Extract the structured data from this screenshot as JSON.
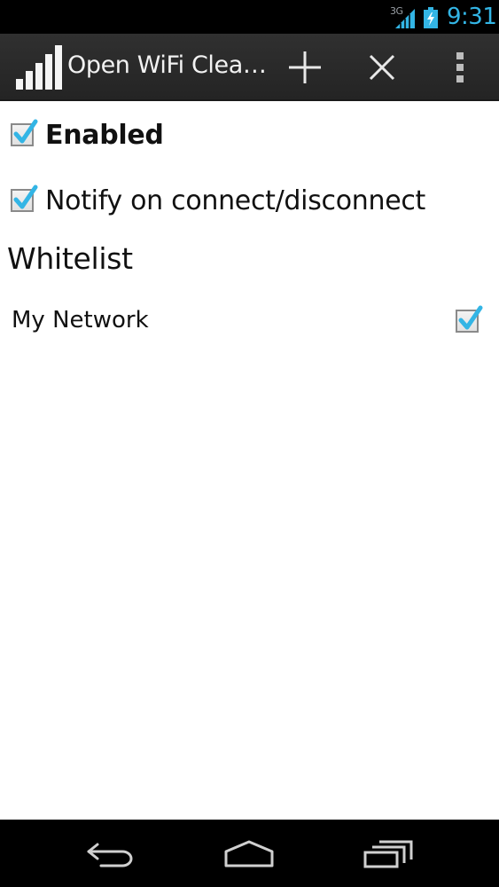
{
  "status_bar": {
    "network_type": "3G",
    "time": "9:31",
    "signal_icon": "signal-icon",
    "battery_icon": "battery-charging-icon"
  },
  "action_bar": {
    "title": "Open WiFi Clea…",
    "app_icon": "wifi-signal-bars-icon",
    "actions": [
      "add-icon",
      "close-icon",
      "overflow-menu-icon"
    ]
  },
  "settings": {
    "enabled_label": "Enabled",
    "enabled_checked": true,
    "notify_label": "Notify on connect/disconnect",
    "notify_checked": true
  },
  "whitelist": {
    "title": "Whitelist",
    "items": [
      {
        "label": "My Network",
        "checked": true
      }
    ]
  },
  "nav_bar": {
    "buttons": [
      "back-icon",
      "home-icon",
      "recents-icon"
    ]
  },
  "colors": {
    "accent": "#33b5e5",
    "action_bar": "#2a2a2a",
    "content_bg": "#ffffff"
  }
}
